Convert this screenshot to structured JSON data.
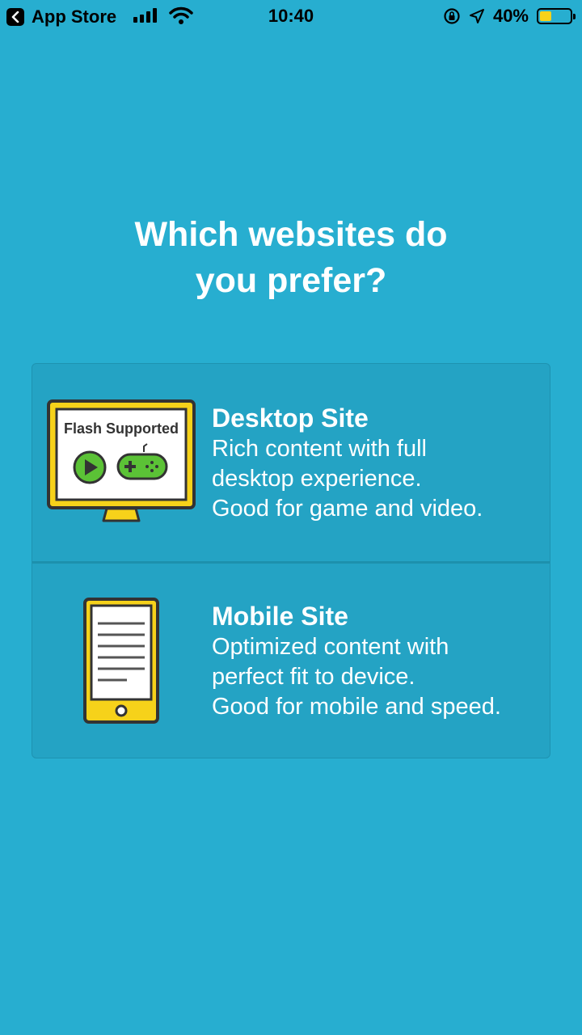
{
  "status_bar": {
    "back_app": "App Store",
    "time": "10:40",
    "battery": "40%",
    "battery_level": 0.4
  },
  "title": {
    "line1": "Which websites do",
    "line2": "you prefer?"
  },
  "options": [
    {
      "name": "Desktop Site",
      "desc_lines": [
        "Rich content with full",
        "desktop experience.",
        "Good for game and video."
      ],
      "icon_label": "Flash Supported"
    },
    {
      "name": "Mobile Site",
      "desc_lines": [
        "Optimized content with",
        "perfect fit to device.",
        "Good for mobile and speed."
      ]
    }
  ]
}
